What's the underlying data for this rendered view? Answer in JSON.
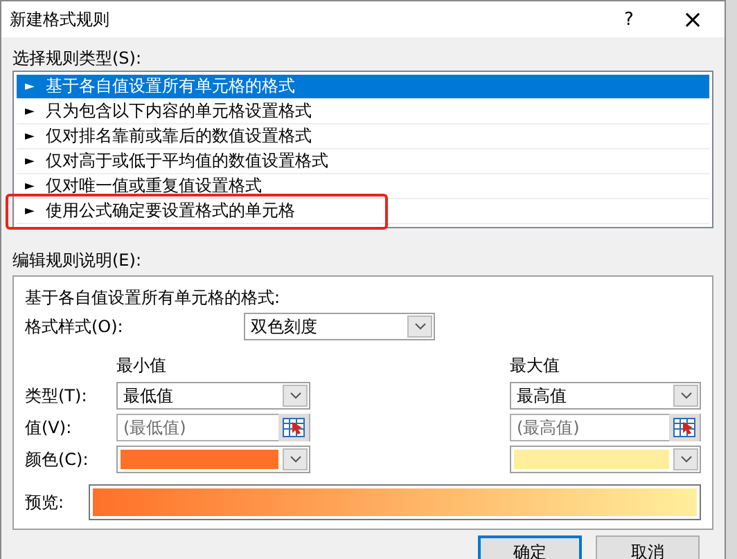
{
  "window": {
    "title": "新建格式规则",
    "help": "?",
    "close": "×"
  },
  "rule_type": {
    "label": "选择规则类型(S):",
    "items": [
      {
        "arrow": "►",
        "label": "基于各自值设置所有单元格的格式",
        "selected": true,
        "highlighted": false
      },
      {
        "arrow": "►",
        "label": "只为包含以下内容的单元格设置格式",
        "selected": false,
        "highlighted": false
      },
      {
        "arrow": "►",
        "label": "仅对排名靠前或靠后的数值设置格式",
        "selected": false,
        "highlighted": false
      },
      {
        "arrow": "►",
        "label": "仅对高于或低于平均值的数值设置格式",
        "selected": false,
        "highlighted": false
      },
      {
        "arrow": "►",
        "label": "仅对唯一值或重复值设置格式",
        "selected": false,
        "highlighted": false
      },
      {
        "arrow": "►",
        "label": "使用公式确定要设置格式的单元格",
        "selected": false,
        "highlighted": true
      }
    ]
  },
  "edit": {
    "label": "编辑规则说明(E):",
    "heading": "基于各自值设置所有单元格的格式:",
    "style_label": "格式样式(O):",
    "style_value": "双色刻度",
    "row_labels": {
      "type": "类型(T):",
      "value": "值(V):",
      "colour_label": "颜色(C):"
    },
    "columns": [
      {
        "heading": "最小值",
        "type": "最低值",
        "value_placeholder": "(最低值)",
        "color": "#ff7128"
      },
      {
        "heading": "最大值",
        "type": "最高值",
        "value_placeholder": "(最高值)",
        "color": "#ffef9c"
      }
    ],
    "preview_label": "预览:"
  },
  "buttons": [
    {
      "label": "确定",
      "default": true
    },
    {
      "label": "取消",
      "default": false
    }
  ]
}
